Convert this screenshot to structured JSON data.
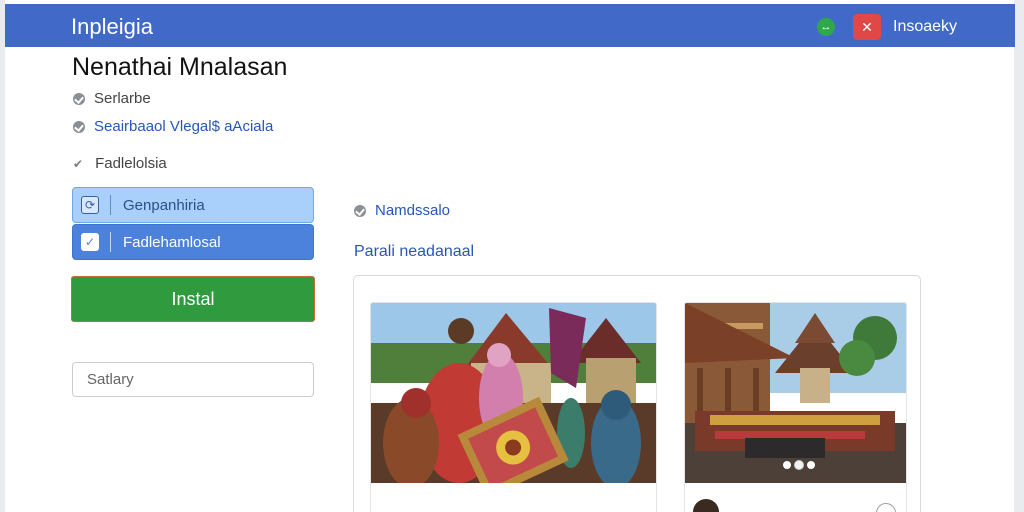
{
  "header": {
    "app_title": "Inpleigia",
    "sync_icon": "sync-icon",
    "notification_icon": "close-icon",
    "user_name": "Insoaeky",
    "bar_color": "#4169c8"
  },
  "page": {
    "title": "Nenathai Mnalasan"
  },
  "left_panel": {
    "items": [
      {
        "label": "Serlarbe",
        "icon": "check-circle-icon"
      },
      {
        "label": "Seairbaaol Vlegal$ aAciala",
        "icon": "check-circle-icon"
      },
      {
        "label": "Fadlelolsia",
        "icon": "checkmark-icon"
      }
    ],
    "options": [
      {
        "label": "Genpanhiria",
        "icon": "refresh-box-icon",
        "selected": false
      },
      {
        "label": "Fadlehamlosal",
        "icon": "checkbox-checked-icon",
        "selected": true
      }
    ],
    "install_label": "Instal",
    "search": {
      "placeholder": "Satlary",
      "value": ""
    }
  },
  "right_panel": {
    "status_label": "Namdssalo",
    "status_icon": "check-circle-icon",
    "link_label": "Parali neadanaal",
    "gallery": {
      "cards": [
        {
          "image": "market-ceremony-photo"
        },
        {
          "image": "temple-procession-photo",
          "carousel_pages": 3,
          "carousel_active": 2
        }
      ]
    }
  },
  "colors": {
    "accent": "#4169c8",
    "install": "#2f9a3e",
    "link": "#2756b8",
    "option_light": "#a9d0fb",
    "option_selected": "#4d82dc"
  }
}
